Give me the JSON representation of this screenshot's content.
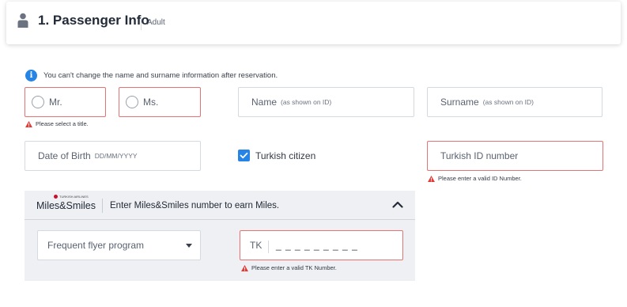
{
  "header": {
    "title": "1. Passenger Info",
    "subtitle": "Adult"
  },
  "notice": "You can't change the name and surname information after reservation.",
  "title_options": [
    {
      "label": "Mr.",
      "selected": false
    },
    {
      "label": "Ms.",
      "selected": false
    }
  ],
  "title_error": "Please select a title.",
  "name_field": {
    "label": "Name",
    "hint": "(as shown on ID)",
    "value": ""
  },
  "surname_field": {
    "label": "Surname",
    "hint": "(as shown on ID)",
    "value": ""
  },
  "dob_field": {
    "label": "Date of Birth",
    "hint": "DD/MM/YYYY",
    "value": ""
  },
  "citizen_checkbox": {
    "label": "Turkish citizen",
    "checked": true
  },
  "turkish_id_field": {
    "placeholder": "Turkish ID number",
    "value": ""
  },
  "turkish_id_error": "Please enter a valid ID Number.",
  "miles": {
    "brand_small": "TURKISH AIRLINES",
    "brand": "Miles&Smiles",
    "prompt": "Enter Miles&Smiles number to earn Miles.",
    "program_select": {
      "selected": "Frequent flyer program"
    },
    "tk_prefix": "TK",
    "tk_mask": "_ _ _ _ _ _ _ _ _",
    "tk_error": "Please enter a valid TK Number."
  },
  "colors": {
    "accent": "#2684e6",
    "error_border": "#e57373",
    "warning": "#e53935",
    "panel_bg": "#eef0f3"
  },
  "icons": {
    "header": "person-icon",
    "notice": "info-icon",
    "error": "warning-triangle-icon",
    "collapse": "chevron-up-icon",
    "select": "caret-down-icon"
  }
}
